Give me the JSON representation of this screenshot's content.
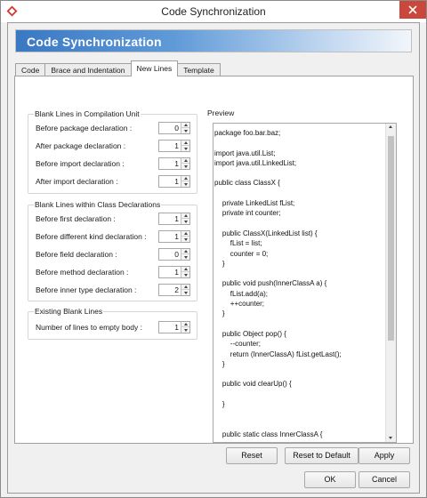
{
  "window": {
    "title": "Code Synchronization",
    "close_icon": "close-icon",
    "app_icon": "vp-logo-icon",
    "close_color": "#c9473b"
  },
  "banner": {
    "title": "Code Synchronization",
    "gradient_start": "#3a78c4",
    "gradient_end": "#f2f6fb"
  },
  "tabs": [
    {
      "label": "Code",
      "active": false
    },
    {
      "label": "Brace and Indentation",
      "active": false
    },
    {
      "label": "New Lines",
      "active": true
    },
    {
      "label": "Template",
      "active": false
    }
  ],
  "groups": {
    "compilation_unit": {
      "title": "Blank Lines in Compilation Unit",
      "rows": [
        {
          "label": "Before package declaration :",
          "value": "0"
        },
        {
          "label": "After package declaration :",
          "value": "1"
        },
        {
          "label": "Before import declaration :",
          "value": "1"
        },
        {
          "label": "After import declaration :",
          "value": "1"
        }
      ]
    },
    "class_declarations": {
      "title": "Blank Lines within Class Declarations",
      "rows": [
        {
          "label": "Before first declaration :",
          "value": "1"
        },
        {
          "label": "Before different kind declaration :",
          "value": "1"
        },
        {
          "label": "Before field declaration :",
          "value": "0"
        },
        {
          "label": "Before method declaration :",
          "value": "1"
        },
        {
          "label": "Before inner type declaration :",
          "value": "2"
        }
      ]
    },
    "existing": {
      "title": "Existing Blank Lines",
      "rows": [
        {
          "label": "Number of lines to empty body :",
          "value": "1"
        }
      ]
    }
  },
  "preview": {
    "title": "Preview",
    "code": "package foo.bar.baz;\n\nimport java.util.List;\nimport java.util.LinkedList;\n\npublic class ClassX {\n\n    private LinkedList fList;\n    private int counter;\n\n    public ClassX(LinkedList list) {\n        fList = list;\n        counter = 0;\n    }\n\n    public void push(InnerClassA a) {\n        fList.add(a);\n        ++counter;\n    }\n\n    public Object pop() {\n        --counter;\n        return (InnerClassA) fList.getLast();\n    }\n\n    public void clearUp() {\n\n    }\n\n\n    public static class InnerClassA {\n\n        public InnerClassA() {"
  },
  "buttons": {
    "reset": "Reset",
    "reset_default": "Reset to Default",
    "apply": "Apply",
    "ok": "OK",
    "cancel": "Cancel"
  }
}
